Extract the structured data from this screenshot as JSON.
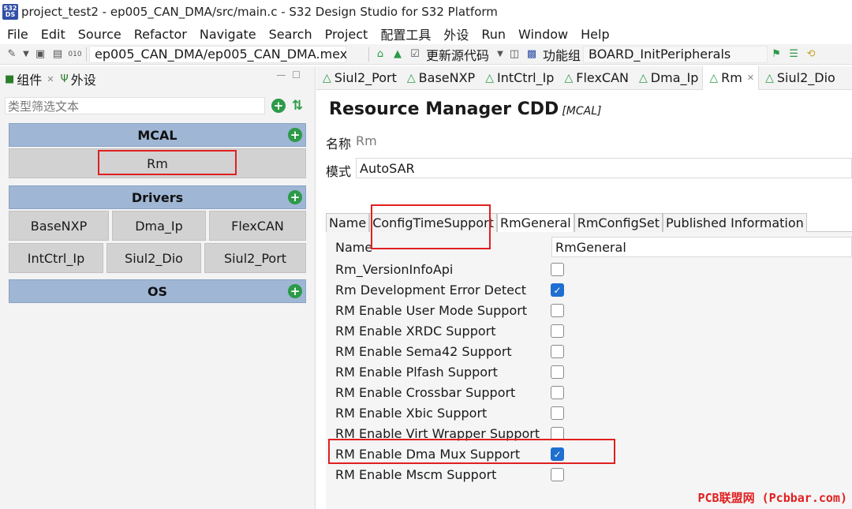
{
  "window": {
    "app_icon_text": "S32 DS",
    "title": "project_test2 - ep005_CAN_DMA/src/main.c - S32 Design Studio for S32 Platform"
  },
  "menu": [
    "File",
    "Edit",
    "Source",
    "Refactor",
    "Navigate",
    "Search",
    "Project",
    "配置工具",
    "外设",
    "Run",
    "Window",
    "Help"
  ],
  "toolbar": {
    "project_path": "ep005_CAN_DMA/ep005_CAN_DMA.mex",
    "update_code_label": "更新源代码",
    "function_group_label": "功能组",
    "function_group_value": "BOARD_InitPeripherals"
  },
  "left_panel": {
    "tabs": [
      {
        "label": "组件",
        "closable": true
      },
      {
        "label": "外设",
        "closable": false
      }
    ],
    "filter_placeholder": "类型筛选文本",
    "groups": {
      "mcal": {
        "title": "MCAL",
        "items": [
          "Rm"
        ]
      },
      "drivers": {
        "title": "Drivers",
        "items": [
          "BaseNXP",
          "Dma_Ip",
          "FlexCAN",
          "IntCtrl_Ip",
          "Siul2_Dio",
          "Siul2_Port"
        ]
      },
      "os": {
        "title": "OS",
        "items": []
      }
    }
  },
  "editor_tabs": [
    {
      "label": "Siul2_Port",
      "active": false
    },
    {
      "label": "BaseNXP",
      "active": false
    },
    {
      "label": "IntCtrl_Ip",
      "active": false
    },
    {
      "label": "FlexCAN",
      "active": false
    },
    {
      "label": "Dma_Ip",
      "active": false
    },
    {
      "label": "Rm",
      "active": true
    },
    {
      "label": "Siul2_Dio",
      "active": false
    }
  ],
  "editor": {
    "title": "Resource Manager CDD",
    "title_sub": "[MCAL]",
    "name_label": "名称",
    "name_value": "Rm",
    "mode_label": "模式",
    "mode_value": "AutoSAR",
    "config_tabs": [
      "Name",
      "ConfigTimeSupport",
      "RmGeneral",
      "RmConfigSet",
      "Published Information"
    ],
    "active_config_tab": "RmGeneral",
    "name_row": {
      "label": "Name",
      "value": "RmGeneral"
    },
    "options": [
      {
        "label": "Rm_VersionInfoApi",
        "checked": false
      },
      {
        "label": "Rm Development Error Detect",
        "checked": true
      },
      {
        "label": "RM Enable User Mode Support",
        "checked": false
      },
      {
        "label": "RM Enable XRDC Support",
        "checked": false
      },
      {
        "label": "RM Enable Sema42 Support",
        "checked": false
      },
      {
        "label": "RM Enable Plfash Support",
        "checked": false
      },
      {
        "label": "RM Enable Crossbar Support",
        "checked": false
      },
      {
        "label": "RM Enable Xbic Support",
        "checked": false
      },
      {
        "label": "RM Enable Virt Wrapper Support",
        "checked": false
      },
      {
        "label": "RM Enable Dma Mux Support",
        "checked": true
      },
      {
        "label": "RM Enable Mscm Support",
        "checked": false
      }
    ]
  },
  "watermark": "PCB联盟网 (Pcbbar.com)",
  "colors": {
    "group_header": "#9fb6d5",
    "highlight_box": "#e02020",
    "checkbox_checked": "#1e6fd0",
    "add_button": "#2c9a48"
  }
}
